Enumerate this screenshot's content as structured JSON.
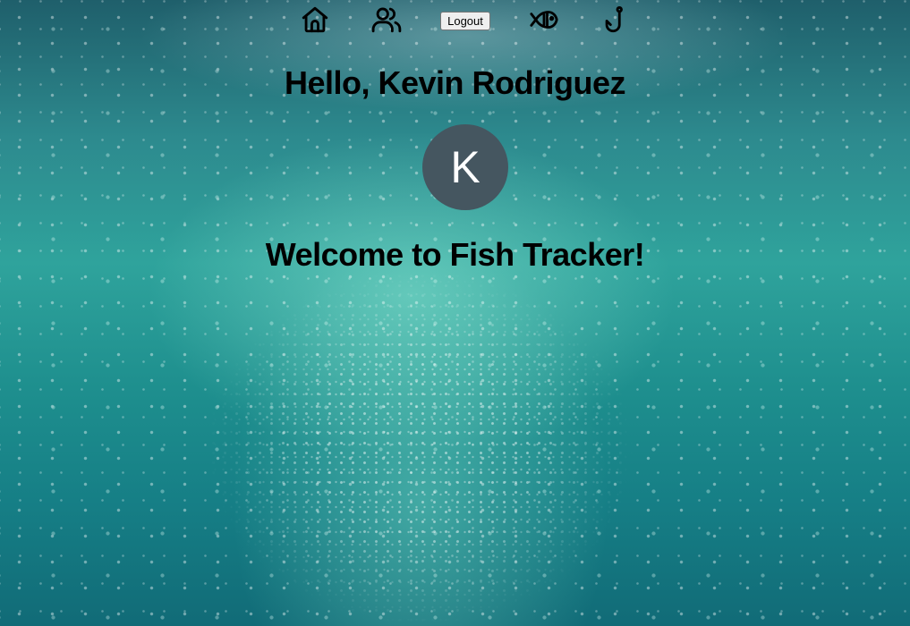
{
  "nav": {
    "items": [
      {
        "icon": "home-icon"
      },
      {
        "icon": "users-icon"
      },
      {
        "icon": "fish-icon"
      },
      {
        "icon": "hook-icon"
      }
    ],
    "logout_label": "Logout"
  },
  "greeting": "Hello, Kevin Rodriguez",
  "avatar": {
    "initial": "K",
    "color": "#455660"
  },
  "welcome": "Welcome to Fish Tracker!",
  "background": {
    "description_colors": [
      "#1f5f6b",
      "#2fa39c",
      "#116b77"
    ]
  }
}
